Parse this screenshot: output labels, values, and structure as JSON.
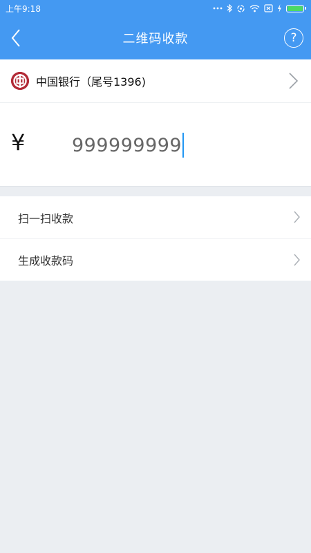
{
  "status_bar": {
    "time": "上午9:18",
    "icons": [
      "more-dots-icon",
      "bluetooth-icon",
      "sync-icon",
      "wifi-icon",
      "no-sim-icon",
      "charging-icon",
      "battery-icon"
    ]
  },
  "header": {
    "title": "二维码收款",
    "back_icon": "chevron-left-icon",
    "help_label": "?"
  },
  "bank_account": {
    "label": "中国银行（尾号1396)",
    "logo": "bank-of-china-logo"
  },
  "amount": {
    "currency_symbol": "¥",
    "value": "999999999"
  },
  "menu": {
    "items": [
      {
        "label": "扫一扫收款"
      },
      {
        "label": "生成收款码"
      }
    ]
  },
  "colors": {
    "brand": "#4499f2",
    "background": "#ebeef2",
    "cursor": "#2196f3",
    "bank_logo": "#b22a36"
  }
}
